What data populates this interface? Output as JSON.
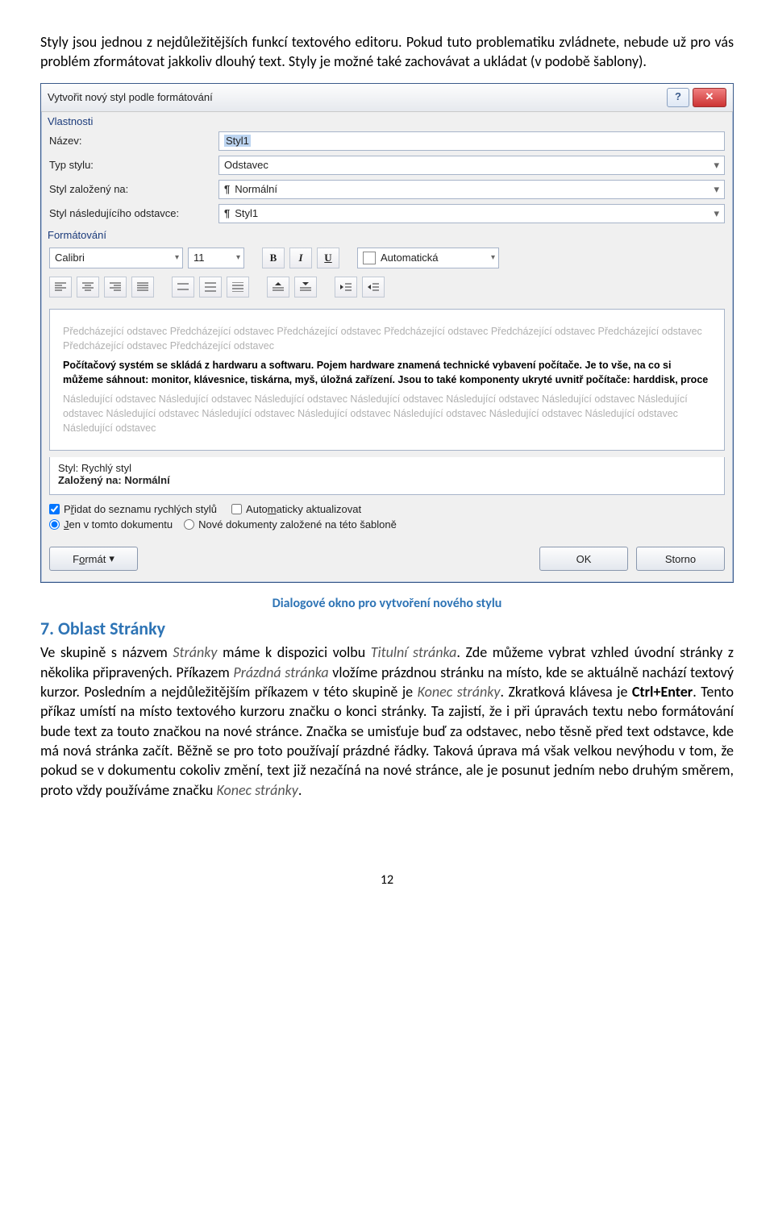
{
  "intro": "Styly jsou jednou z nejdůležitějších funkcí textového editoru. Pokud tuto problematiku zvládnete, nebude už pro vás problém zformátovat jakkoliv dlouhý text. Styly je možné také zachovávat a ukládat (v podobě šablony).",
  "dialog": {
    "title": "Vytvořit nový styl podle formátování",
    "section_properties": "Vlastnosti",
    "name_label": "Název:",
    "name_value": "Styl1",
    "type_label": "Typ stylu:",
    "type_value": "Odstavec",
    "based_label": "Styl založený na:",
    "based_value": "Normální",
    "following_label": "Styl následujícího odstavce:",
    "following_value": "Styl1",
    "section_format": "Formátování",
    "font_name": "Calibri",
    "font_size": "11",
    "color_value": "Automatická",
    "preview_ghost_before": "Předcházející odstavec Předcházející odstavec Předcházející odstavec Předcházející odstavec Předcházející odstavec Předcházející odstavec Předcházející odstavec Předcházející odstavec",
    "preview_sample": "Počítačový systém se skládá z hardwaru a softwaru. Pojem hardware znamená technické vybavení počítače. Je to vše, na co si můžeme sáhnout: monitor, klávesnice, tiskárna, myš, úložná zařízení. Jsou to také komponenty ukryté uvnitř počítače: harddisk, proce",
    "preview_ghost_after": "Následující odstavec Následující odstavec Následující odstavec Následující odstavec Následující odstavec Následující odstavec Následující odstavec Následující odstavec Následující odstavec Následující odstavec Následující odstavec Následující odstavec Následující odstavec Následující odstavec",
    "style_line": "Styl: Rychlý styl",
    "based_line": "Založený na: Normální",
    "chk_quick_pre": "P",
    "chk_quick_u": "ř",
    "chk_quick_post": "idat do seznamu rychlých stylů",
    "chk_auto_pre": "Auto",
    "chk_auto_u": "m",
    "chk_auto_post": "aticky aktualizovat",
    "rad_doc_u": "J",
    "rad_doc_post": "en v tomto dokumentu",
    "rad_tpl": "Nové dokumenty založené na této šabloně",
    "btn_format_pre": "F",
    "btn_format_u": "o",
    "btn_format_post": "rmát",
    "btn_ok": "OK",
    "btn_cancel": "Storno"
  },
  "caption": "Dialogové okno pro vytvoření nového stylu",
  "heading": "7. Oblast Stránky",
  "body": {
    "p1a": "Ve skupině s názvem ",
    "t1": "Stránky",
    "p1b": " máme k dispozici volbu ",
    "t2": "Titulní stránka",
    "p1c": ". Zde můžeme vybrat vzhled úvodní stránky z několika připravených. Příkazem ",
    "t3": "Prázdná stránka",
    "p1d": " vložíme prázdnou stránku na místo, kde se aktuálně nachází textový kurzor. Posledním a nejdůležitějším příkazem v této skupině je ",
    "t4": "Konec stránky",
    "p1e": ". Zkratková klávesa je ",
    "kbd": "Ctrl+Enter",
    "p1f": ". Tento příkaz umístí na místo textového kurzoru značku o konci stránky. Ta zajistí, že i při úpravách textu nebo formátování bude text za touto značkou na nové stránce. Značka se umisťuje buď za odstavec, nebo těsně před text odstavce, kde má nová stránka začít. Běžně se pro toto používají prázdné řádky. Taková úprava má však velkou nevýhodu v tom, že pokud se v dokumentu cokoliv změní, text již nezačíná na nové stránce, ale je posunut jedním nebo druhým směrem, proto vždy používáme značku ",
    "t5": "Konec stránky",
    "p1g": "."
  },
  "pagenum": "12"
}
